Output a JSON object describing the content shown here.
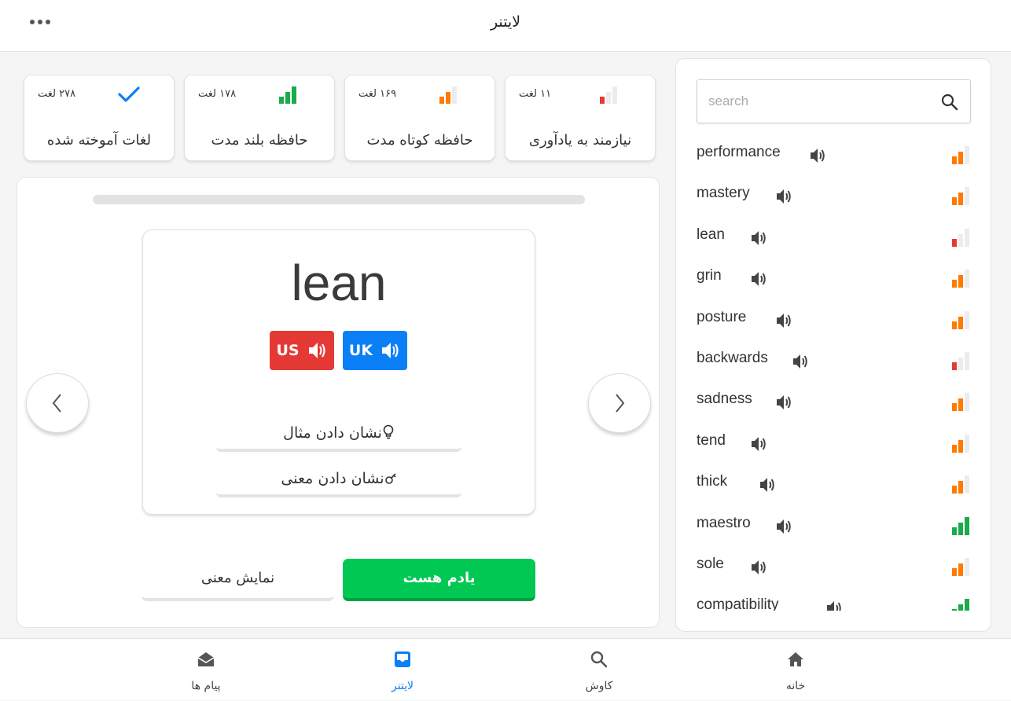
{
  "app": {
    "title": "لایتنر",
    "more_icon": "more-horizontal-icon"
  },
  "stats": [
    {
      "label": "نیازمند به یادآوری",
      "count": "۱۱ لغت",
      "icon": "level-1-icon",
      "color": "#e53935"
    },
    {
      "label": "حافظه کوتاه مدت",
      "count": "۱۶۹ لغت",
      "icon": "level-2-icon",
      "color": "#ff7a00"
    },
    {
      "label": "حافظه بلند مدت",
      "count": "۱۷۸ لغت",
      "icon": "level-3-icon",
      "color": "#1aab4b"
    },
    {
      "label": "لغات آموخته شده",
      "count": "۲۷۸ لغت",
      "icon": "check-icon",
      "color": "#0b7ff5"
    }
  ],
  "card": {
    "progress": 0,
    "word": "lean",
    "accents": {
      "uk": "UK",
      "us": "US"
    },
    "show_example": "نشان دادن مثال",
    "show_meaning": "نشان دادن معنی",
    "know_button": "یادم هست",
    "show_meaning_button": "نمایش معنی"
  },
  "search": {
    "placeholder": "search"
  },
  "words": [
    {
      "word": "performance",
      "level": 2
    },
    {
      "word": "mastery",
      "level": 2
    },
    {
      "word": "lean",
      "level": 1
    },
    {
      "word": "grin",
      "level": 2
    },
    {
      "word": "posture",
      "level": 2
    },
    {
      "word": "backwards",
      "level": 1
    },
    {
      "word": "sadness",
      "level": 2
    },
    {
      "word": "tend",
      "level": 2
    },
    {
      "word": "thick",
      "level": 2
    },
    {
      "word": "maestro",
      "level": 3
    },
    {
      "word": "sole",
      "level": 2
    },
    {
      "word": "compatibility",
      "level": 3
    }
  ],
  "level_colors": {
    "1": "#e53935",
    "2": "#ff7a00",
    "3": "#1aab4b",
    "empty": "#ececec"
  },
  "bottom_nav": [
    {
      "label": "پیام ها",
      "icon": "mail-open-icon",
      "active": false
    },
    {
      "label": "لایتنر",
      "icon": "inbox-tray-icon",
      "active": true
    },
    {
      "label": "کاوش",
      "icon": "search-icon",
      "active": false
    },
    {
      "label": "خانه",
      "icon": "home-icon",
      "active": false
    }
  ],
  "accent_color": "#0b7ff5"
}
